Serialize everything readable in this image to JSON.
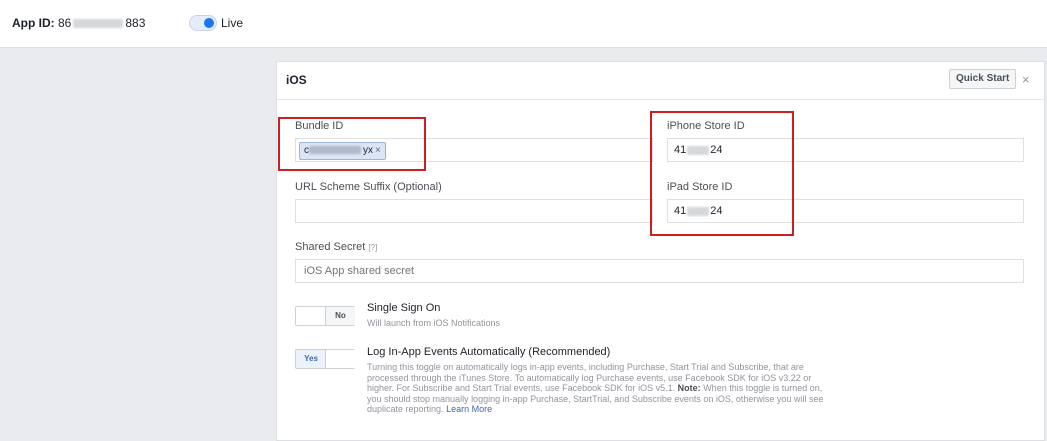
{
  "topbar": {
    "app_id_label": "App ID:",
    "app_id_start": "86",
    "app_id_end": "883",
    "live_label": "Live"
  },
  "panel": {
    "title": "iOS",
    "quick_start": "Quick Start",
    "close": "×"
  },
  "fields": {
    "bundle_id_label": "Bundle ID",
    "bundle_chip_start": "c",
    "bundle_chip_end": "yx",
    "chip_remove": "×",
    "iphone_label": "iPhone Store ID",
    "iphone_start": "41",
    "iphone_end": "24",
    "url_suffix_label": "URL Scheme Suffix (Optional)",
    "ipad_label": "iPad Store ID",
    "ipad_start": "41",
    "ipad_end": "24",
    "shared_secret_label": "Shared Secret",
    "shared_secret_help": "[?]",
    "shared_secret_placeholder": "iOS App shared secret"
  },
  "sso": {
    "toggle": "No",
    "title": "Single Sign On",
    "desc": "Will launch from iOS Notifications"
  },
  "log_events": {
    "toggle": "Yes",
    "title": "Log In-App Events Automatically (Recommended)",
    "desc1": "Turning this toggle on automatically logs in-app events, including Purchase, Start Trial and Subscribe, that are processed through the iTunes Store. To automatically log Purchase events, use Facebook SDK for iOS v3.22 or higher. For Subscribe and Start Trial events, use Facebook SDK for iOS v5.1.",
    "note_label": "Note:",
    "desc2": "When this toggle is turned on, you should stop manually logging in-app Purchase, StartTrial, and Subscribe events on iOS, otherwise you will see duplicate reporting.",
    "learn_more": "Learn More"
  },
  "colors": {
    "highlight": "#cc1f1f",
    "accent": "#1877f2"
  }
}
